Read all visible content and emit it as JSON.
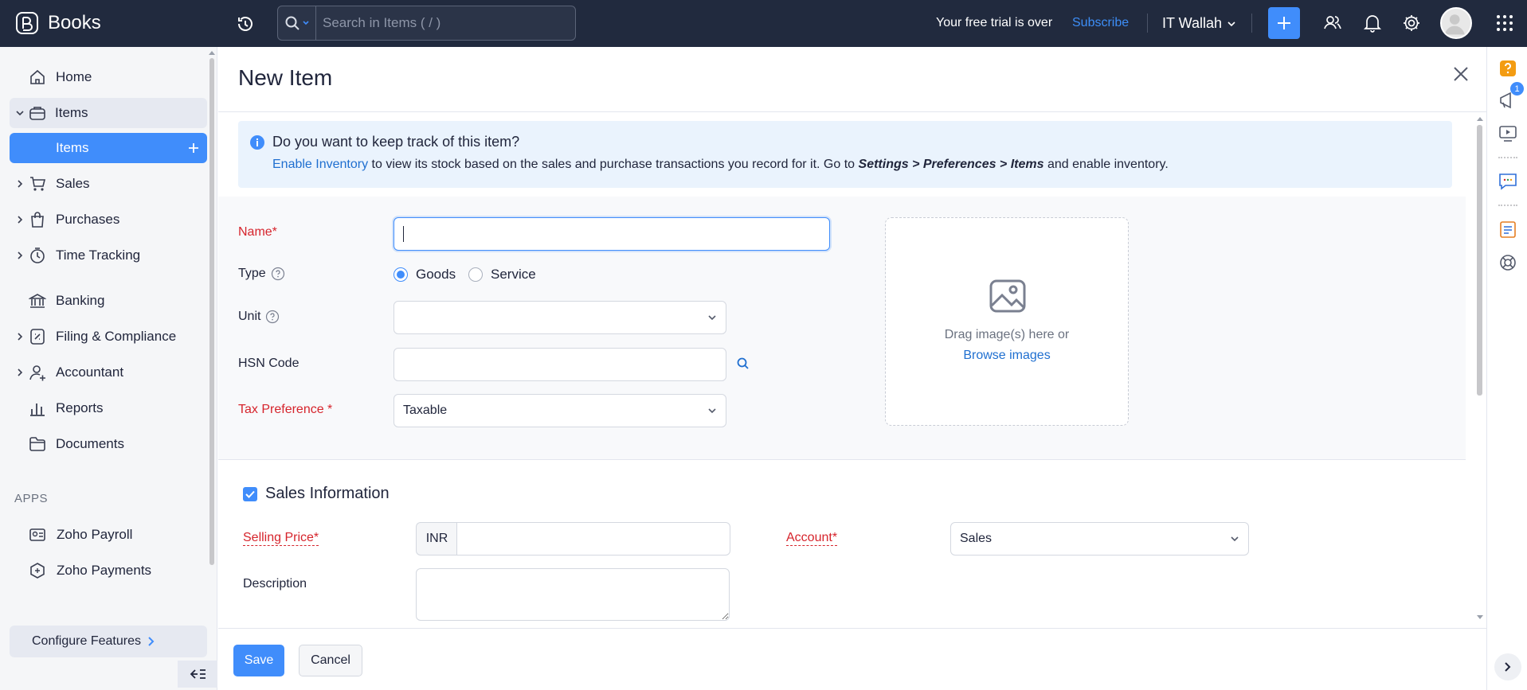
{
  "app": {
    "name": "Books"
  },
  "topbar": {
    "search_placeholder": "Search in Items ( / )",
    "trial_text": "Your free trial is over",
    "subscribe_label": "Subscribe",
    "org_name": "IT Wallah"
  },
  "sidebar": {
    "items": [
      {
        "label": "Home"
      },
      {
        "label": "Items"
      },
      {
        "label": "Items"
      },
      {
        "label": "Sales"
      },
      {
        "label": "Purchases"
      },
      {
        "label": "Time Tracking"
      },
      {
        "label": "Banking"
      },
      {
        "label": "Filing & Compliance"
      },
      {
        "label": "Accountant"
      },
      {
        "label": "Reports"
      },
      {
        "label": "Documents"
      }
    ],
    "apps_heading": "APPS",
    "apps": [
      {
        "label": "Zoho Payroll"
      },
      {
        "label": "Zoho Payments"
      }
    ],
    "configure_label": "Configure Features"
  },
  "page": {
    "title": "New Item"
  },
  "info_banner": {
    "question": "Do you want to keep track of this item?",
    "link": "Enable Inventory",
    "text_1": " to view its stock based on the sales and purchase transactions you record for it. Go to ",
    "path": "Settings > Preferences > Items",
    "text_2": " and enable inventory."
  },
  "form": {
    "name_label": "Name*",
    "name_value": "",
    "type_label": "Type",
    "type_options": [
      "Goods",
      "Service"
    ],
    "type_selected": "Goods",
    "unit_label": "Unit",
    "unit_value": "",
    "hsn_label": "HSN Code",
    "hsn_value": "",
    "tax_label": "Tax Preference *",
    "tax_value": "Taxable"
  },
  "image_upload": {
    "text": "Drag image(s) here or",
    "link": "Browse images"
  },
  "sales_info": {
    "title": "Sales Information",
    "checked": true,
    "selling_price_label": "Selling Price*",
    "currency": "INR",
    "selling_price_value": "",
    "account_label": "Account*",
    "account_value": "Sales",
    "description_label": "Description",
    "description_value": ""
  },
  "footer": {
    "save_label": "Save",
    "cancel_label": "Cancel"
  },
  "right_rail": {
    "notification_count": "1"
  },
  "colors": {
    "topbar": "#212a3e",
    "accent": "#408dfb",
    "required": "#d6242c",
    "link": "#1f6fd0"
  },
  "icons": [
    "books-logo-icon",
    "recent-icon",
    "search-icon",
    "chevron-down-icon",
    "plus-icon",
    "people-icon",
    "bell-icon",
    "gear-icon",
    "avatar",
    "app-grid-icon",
    "home-icon",
    "items-icon",
    "sales-icon",
    "purchases-icon",
    "time-tracking-icon",
    "banking-icon",
    "filing-icon",
    "accountant-icon",
    "reports-icon",
    "documents-icon",
    "zoho-payroll-icon",
    "zoho-payments-icon",
    "info-icon",
    "help-icon",
    "close-icon",
    "image-icon",
    "magnifier-icon"
  ]
}
